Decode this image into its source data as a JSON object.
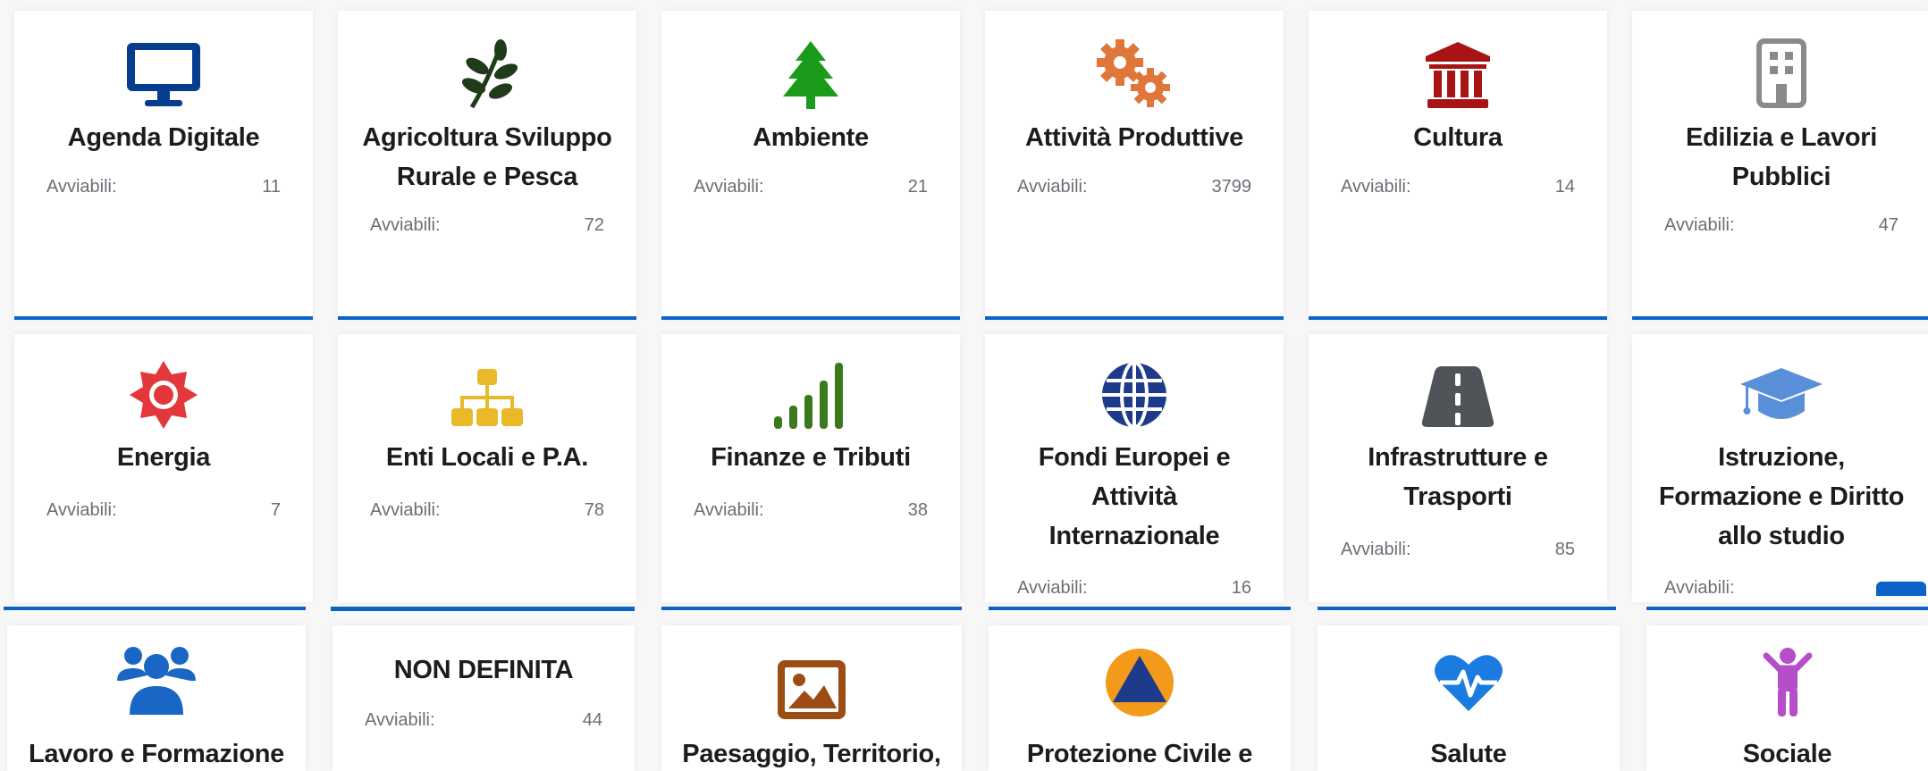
{
  "avviabili_label": "Avviabili:",
  "colors": {
    "accent_bar": "#0b63c9"
  },
  "cards": [
    {
      "id": "agenda-digitale",
      "title_lines": [
        "Agenda Digitale"
      ],
      "count": "11",
      "icon": "monitor-icon",
      "icon_color": "#073d8e"
    },
    {
      "id": "agricoltura",
      "title_lines": [
        "Agricoltura Sviluppo",
        "Rurale e Pesca"
      ],
      "count": "72",
      "icon": "leaf-branch-icon",
      "icon_color": "#1f3b1a"
    },
    {
      "id": "ambiente",
      "title_lines": [
        "Ambiente"
      ],
      "count": "21",
      "icon": "tree-icon",
      "icon_color": "#1a9b1a"
    },
    {
      "id": "attivita-produttive",
      "title_lines": [
        "Attività Produttive"
      ],
      "count": "3799",
      "icon": "gears-icon",
      "icon_color": "#e0763a"
    },
    {
      "id": "cultura",
      "title_lines": [
        "Cultura"
      ],
      "count": "14",
      "icon": "museum-icon",
      "icon_color": "#a81414"
    },
    {
      "id": "edilizia",
      "title_lines": [
        "Edilizia e Lavori",
        "Pubblici"
      ],
      "count": "47",
      "icon": "building-icon",
      "icon_color": "#8a8a8a"
    },
    {
      "id": "energia",
      "title_lines": [
        "Energia"
      ],
      "count": "7",
      "icon": "sun-icon",
      "icon_color": "#e4373c"
    },
    {
      "id": "enti-locali",
      "title_lines": [
        "Enti Locali e P.A."
      ],
      "count": "78",
      "icon": "sitemap-icon",
      "icon_color": "#eab92a"
    },
    {
      "id": "finanze",
      "title_lines": [
        "Finanze e Tributi"
      ],
      "count": "38",
      "icon": "signal-bars-icon",
      "icon_color": "#3a7a1c"
    },
    {
      "id": "fondi-europei",
      "title_lines": [
        "Fondi Europei e",
        "Attività",
        "Internazionale"
      ],
      "count": "16",
      "icon": "globe-icon",
      "icon_color": "#1d3b8a"
    },
    {
      "id": "infrastrutture",
      "title_lines": [
        "Infrastrutture e",
        "Trasporti"
      ],
      "count": "85",
      "icon": "road-icon",
      "icon_color": "#505458"
    },
    {
      "id": "istruzione",
      "title_lines": [
        "Istruzione,",
        "Formazione e Diritto",
        "allo studio"
      ],
      "count": "",
      "icon": "graduation-cap-icon",
      "icon_color": "#5a8fd9"
    },
    {
      "id": "lavoro",
      "title_lines": [
        "Lavoro e Formazione"
      ],
      "count": "",
      "icon": "users-icon",
      "icon_color": "#1a66c4"
    },
    {
      "id": "non-definita",
      "title_lines": [
        "NON DEFINITA"
      ],
      "count": "44",
      "icon": "",
      "icon_color": ""
    },
    {
      "id": "paesaggio",
      "title_lines": [
        "Paesaggio, Territorio,"
      ],
      "count": "",
      "icon": "image-icon",
      "icon_color": "#9b4d14"
    },
    {
      "id": "protezione-civile",
      "title_lines": [
        "Protezione Civile e"
      ],
      "count": "",
      "icon": "civil-protection-icon",
      "icon_color": "#f39a1a"
    },
    {
      "id": "salute",
      "title_lines": [
        "Salute"
      ],
      "count": "",
      "icon": "heartbeat-icon",
      "icon_color": "#1a7be0"
    },
    {
      "id": "sociale",
      "title_lines": [
        "Sociale"
      ],
      "count": "",
      "icon": "child-icon",
      "icon_color": "#b64ec9"
    }
  ]
}
